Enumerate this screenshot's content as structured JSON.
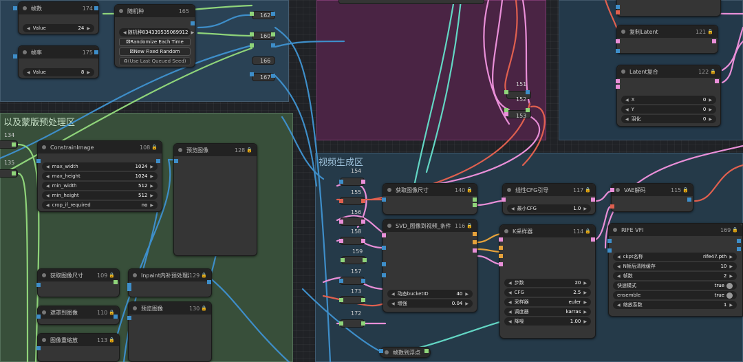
{
  "groups": {
    "preprocess": {
      "title": "以及蒙版预处理区"
    },
    "video": {
      "title": "视频生成区"
    }
  },
  "nodes": {
    "frames": {
      "title": "帧数",
      "id": "174",
      "widget": {
        "label": "Value",
        "value": "24"
      }
    },
    "fps": {
      "title": "帧率",
      "id": "175",
      "widget": {
        "label": "Value",
        "value": "8"
      }
    },
    "seed": {
      "title": "随机种",
      "id": "165",
      "widget": {
        "label": "随机种",
        "value": "834339535069912"
      },
      "buttons": [
        "Randomize Each Time",
        "New Fixed Random",
        "(Use Last Queued Seed)"
      ]
    },
    "constrain": {
      "title": "ConstrainImage",
      "id": "108",
      "widgets": [
        {
          "label": "max_width",
          "value": "1024"
        },
        {
          "label": "max_height",
          "value": "1024"
        },
        {
          "label": "min_width",
          "value": "512"
        },
        {
          "label": "min_height",
          "value": "512"
        },
        {
          "label": "crop_if_required",
          "value": "no"
        }
      ]
    },
    "preview1": {
      "title": "预览图像",
      "id": "128"
    },
    "getsize1": {
      "title": "获取图像尺寸",
      "id": "109"
    },
    "inpaint": {
      "title": "Inpaint内补预处理器",
      "id": "129"
    },
    "mask": {
      "title": "遮罩到图像",
      "id": "110"
    },
    "preview2": {
      "title": "预览图像",
      "id": "130"
    },
    "scale": {
      "title": "图像重缩放",
      "id": "113"
    },
    "getsize2": {
      "title": "获取图像尺寸",
      "id": "140"
    },
    "svd": {
      "title": "SVD_图像到视频_条件",
      "id": "116",
      "widgets": [
        {
          "label": "动态bucketID",
          "value": "40"
        },
        {
          "label": "增强",
          "value": "0.04"
        }
      ]
    },
    "cfg": {
      "title": "线性CFG引导",
      "id": "117",
      "widget": {
        "label": "最小CFG",
        "value": "1.0"
      }
    },
    "vae": {
      "title": "VAE解码",
      "id": "115"
    },
    "ksampler": {
      "title": "K采样器",
      "id": "114",
      "widgets": [
        {
          "label": "步数",
          "value": "20"
        },
        {
          "label": "CFG",
          "value": "2.5"
        },
        {
          "label": "采样器",
          "value": "euler"
        },
        {
          "label": "调度器",
          "value": "karras"
        },
        {
          "label": "降噪",
          "value": "1.00"
        }
      ]
    },
    "rife": {
      "title": "RIFE VFI",
      "id": "169",
      "widgets": [
        {
          "label": "ckpt名称",
          "value": "rife47.pth"
        },
        {
          "label": "N帧后清除缓存",
          "value": "10"
        },
        {
          "label": "帧数",
          "value": "2"
        },
        {
          "label": "快速模式",
          "value": "true"
        },
        {
          "label": "ensemble",
          "value": "true"
        },
        {
          "label": "缩放系数",
          "value": "1"
        }
      ]
    },
    "copylatent": {
      "title": "复制Latent",
      "id": "121"
    },
    "latentcomp": {
      "title": "Latent复合",
      "id": "122",
      "widgets": [
        {
          "label": "X",
          "value": "0"
        },
        {
          "label": "Y",
          "value": "0"
        },
        {
          "label": "羽化",
          "value": "0"
        }
      ]
    },
    "pull": {
      "title": "帧数到浮点"
    }
  },
  "reroutes": [
    "162",
    "160",
    "166",
    "167",
    "151",
    "152",
    "153",
    "134",
    "135",
    "154",
    "155",
    "156",
    "158",
    "159",
    "157",
    "173",
    "172"
  ],
  "colors": {
    "group_preprocess": "#3f5a3f",
    "group_video": "#2b4556",
    "group_top": "#2b4556",
    "group_magenta": "#5a2850",
    "wire_blue": "#3e8ec9",
    "wire_green": "#8fd47a",
    "wire_pink": "#e98fd8",
    "wire_red": "#e0604f",
    "wire_orange": "#e6a23b",
    "wire_teal": "#63d6c4"
  }
}
